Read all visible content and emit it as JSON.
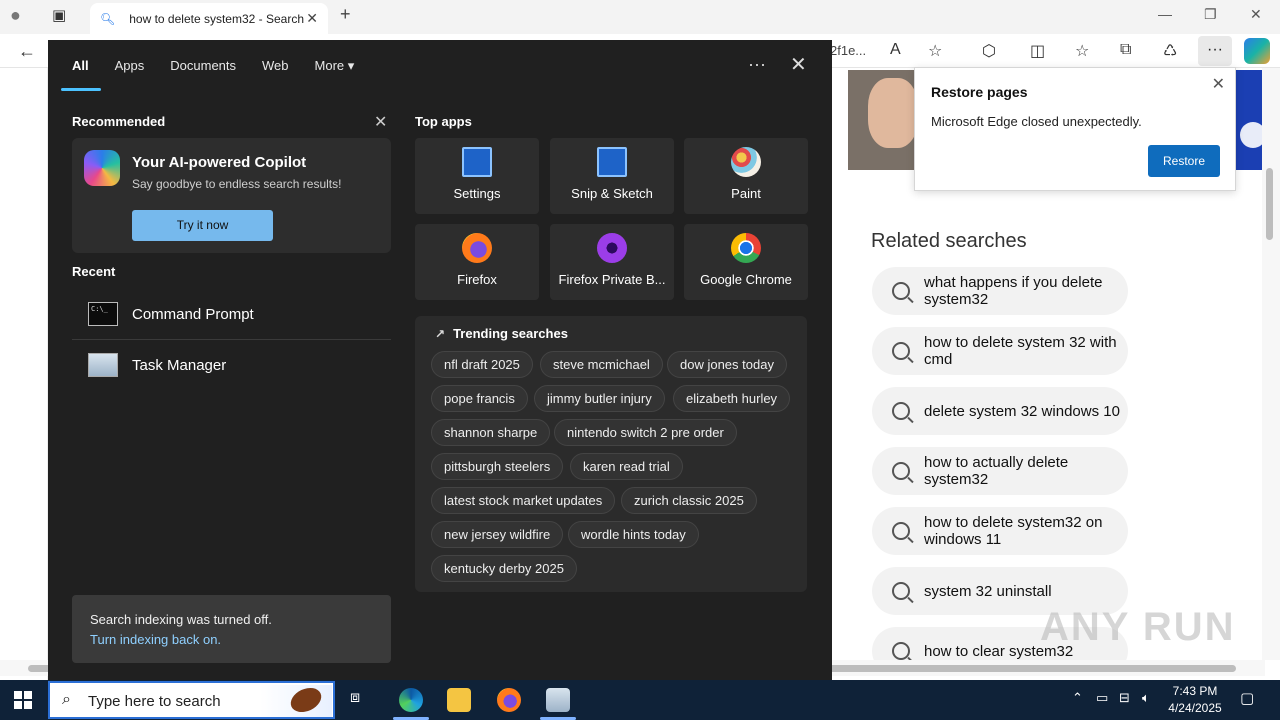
{
  "browser": {
    "tab_title": "how to delete system32 - Search",
    "url_fragment": "2f1e..."
  },
  "restore_popup": {
    "title": "Restore pages",
    "message": "Microsoft Edge closed unexpectedly.",
    "button": "Restore"
  },
  "related": {
    "title": "Related searches",
    "items": [
      "what happens if you delete system32",
      "how to delete system 32 with cmd",
      "delete system 32 windows 10",
      "how to actually delete system32",
      "how to delete system32 on windows 11",
      "system 32 uninstall",
      "how to clear system32"
    ]
  },
  "watermark": "ANY RUN",
  "search_panel": {
    "tabs": [
      "All",
      "Apps",
      "Documents",
      "Web",
      "More"
    ],
    "recommended_label": "Recommended",
    "copilot": {
      "title": "Your AI-powered Copilot",
      "subtitle": "Say goodbye to endless search results!",
      "button": "Try it now"
    },
    "recent_label": "Recent",
    "recent": [
      "Command Prompt",
      "Task Manager"
    ],
    "top_apps_label": "Top apps",
    "top_apps": [
      "Settings",
      "Snip & Sketch",
      "Paint",
      "Firefox",
      "Firefox Private B...",
      "Google Chrome"
    ],
    "trending_label": "Trending searches",
    "trending": [
      "nfl draft 2025",
      "steve mcmichael",
      "dow jones today",
      "pope francis",
      "jimmy butler injury",
      "elizabeth hurley",
      "shannon sharpe",
      "nintendo switch 2 pre order",
      "pittsburgh steelers",
      "karen read trial",
      "latest stock market updates",
      "zurich classic 2025",
      "new jersey wildfire",
      "wordle hints today",
      "kentucky derby 2025"
    ],
    "index_note": {
      "line1": "Search indexing was turned off.",
      "link": "Turn indexing back on."
    }
  },
  "taskbar": {
    "search_placeholder": "Type here to search",
    "time": "7:43 PM",
    "date": "4/24/2025"
  }
}
